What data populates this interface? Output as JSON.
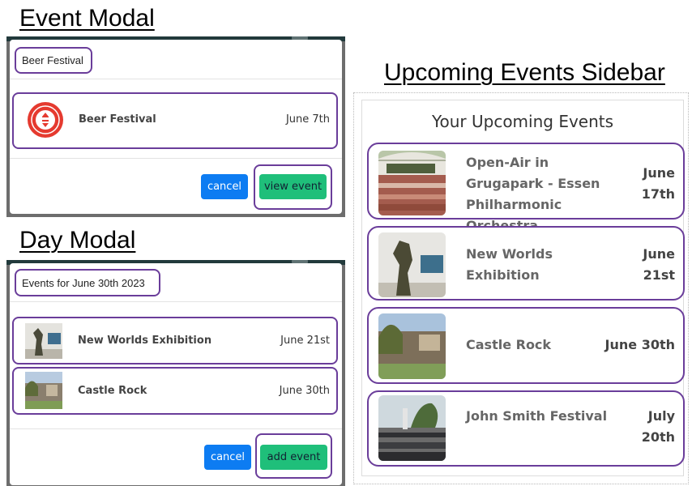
{
  "headings": {
    "event_modal": "Event Modal",
    "day_modal": "Day Modal",
    "sidebar": "Upcoming Events Sidebar"
  },
  "event_modal": {
    "title": "Beer Festival",
    "event": {
      "name": "Beer Festival",
      "date": "June 7th",
      "icon": "festival-badge-icon"
    },
    "cancel_label": "cancel",
    "primary_label": "view event"
  },
  "day_modal": {
    "title": "Events for June 30th 2023",
    "events": [
      {
        "name": "New Worlds Exhibition",
        "date": "June 21st"
      },
      {
        "name": "Castle Rock",
        "date": "June 30th"
      }
    ],
    "cancel_label": "cancel",
    "primary_label": "add event"
  },
  "sidebar": {
    "title": "Your Upcoming Events",
    "events": [
      {
        "name": "Open-Air in Grugapark - Essen Philharmonic Orchestra",
        "date": "June 17th"
      },
      {
        "name": "New Worlds Exhibition",
        "date": "June 21st"
      },
      {
        "name": "Castle Rock",
        "date": "June 30th"
      },
      {
        "name": "John Smith Festival",
        "date": "July 20th"
      }
    ]
  },
  "colors": {
    "highlight_outline": "#6a3d9a",
    "cancel_button": "#0d7cf2",
    "primary_button": "#1fbf7a",
    "festival_badge": "#e53a2f"
  }
}
